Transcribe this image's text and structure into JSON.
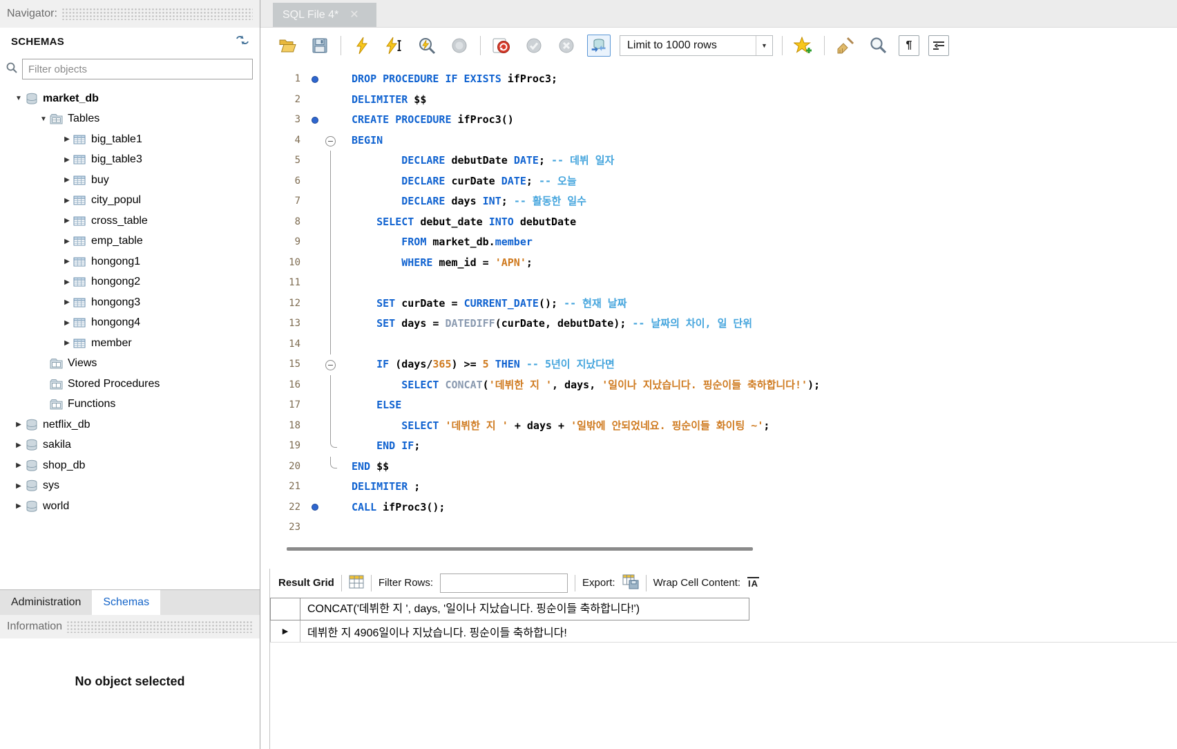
{
  "colors": {
    "keyword": "#0f62d0",
    "string": "#cf7a1f",
    "comment": "#45a5dd",
    "function": "#8a9ab0",
    "accent_blue": "#1464c8"
  },
  "navigator": {
    "title": "Navigator",
    "schemas_header": "SCHEMAS",
    "filter_placeholder": "Filter objects",
    "tree": [
      {
        "label": "market_db",
        "level": 0,
        "arrow": "down",
        "icon": "schema",
        "bold": true
      },
      {
        "label": "Tables",
        "level": 1,
        "arrow": "down",
        "icon": "tables"
      },
      {
        "label": "big_table1",
        "level": 2,
        "arrow": "right",
        "icon": "table"
      },
      {
        "label": "big_table3",
        "level": 2,
        "arrow": "right",
        "icon": "table"
      },
      {
        "label": "buy",
        "level": 2,
        "arrow": "right",
        "icon": "table"
      },
      {
        "label": "city_popul",
        "level": 2,
        "arrow": "right",
        "icon": "table"
      },
      {
        "label": "cross_table",
        "level": 2,
        "arrow": "right",
        "icon": "table"
      },
      {
        "label": "emp_table",
        "level": 2,
        "arrow": "right",
        "icon": "table"
      },
      {
        "label": "hongong1",
        "level": 2,
        "arrow": "right",
        "icon": "table"
      },
      {
        "label": "hongong2",
        "level": 2,
        "arrow": "right",
        "icon": "table"
      },
      {
        "label": "hongong3",
        "level": 2,
        "arrow": "right",
        "icon": "table"
      },
      {
        "label": "hongong4",
        "level": 2,
        "arrow": "right",
        "icon": "table"
      },
      {
        "label": "member",
        "level": 2,
        "arrow": "right",
        "icon": "table"
      },
      {
        "label": "Views",
        "level": 1,
        "arrow": null,
        "icon": "group"
      },
      {
        "label": "Stored Procedures",
        "level": 1,
        "arrow": null,
        "icon": "group"
      },
      {
        "label": "Functions",
        "level": 1,
        "arrow": null,
        "icon": "group"
      },
      {
        "label": "netflix_db",
        "level": 0,
        "arrow": "right",
        "icon": "schema"
      },
      {
        "label": "sakila",
        "level": 0,
        "arrow": "right",
        "icon": "schema"
      },
      {
        "label": "shop_db",
        "level": 0,
        "arrow": "right",
        "icon": "schema"
      },
      {
        "label": "sys",
        "level": 0,
        "arrow": "right",
        "icon": "schema"
      },
      {
        "label": "world",
        "level": 0,
        "arrow": "right",
        "icon": "schema"
      }
    ],
    "bottom_tabs": [
      {
        "label": "Administration",
        "active": false
      },
      {
        "label": "Schemas",
        "active": true
      }
    ],
    "information_header": "Information",
    "no_object": "No object selected"
  },
  "editor": {
    "tab_title": "SQL File 4*",
    "limit_dropdown": "Limit to 1000 rows",
    "toolbar_icons": [
      "open-file",
      "save",
      "execute",
      "execute-current-statement",
      "explain",
      "stop",
      "toggle-stop-on-error",
      "commit",
      "rollback",
      "toggle-autocommit",
      "limit-rows-dropdown",
      "save-snippet",
      "beautify",
      "find",
      "toggle-invisible-characters",
      "toggle-word-wrap"
    ],
    "lines": [
      {
        "n": 1,
        "m": "dot",
        "f": "",
        "s": [
          {
            "t": "kw",
            "v": "DROP PROCEDURE IF EXISTS"
          },
          {
            "t": "id",
            "v": " ifProc3;"
          }
        ]
      },
      {
        "n": 2,
        "m": "",
        "f": "",
        "s": [
          {
            "t": "kw",
            "v": "DELIMITER"
          },
          {
            "t": "id",
            "v": " $$"
          }
        ]
      },
      {
        "n": 3,
        "m": "dot",
        "f": "",
        "s": [
          {
            "t": "kw",
            "v": "CREATE PROCEDURE"
          },
          {
            "t": "id",
            "v": " ifProc3()"
          }
        ]
      },
      {
        "n": 4,
        "m": "",
        "f": "open",
        "s": [
          {
            "t": "kw",
            "v": "BEGIN"
          }
        ]
      },
      {
        "n": 5,
        "m": "",
        "f": "line",
        "s": [
          {
            "t": "id",
            "v": "        "
          },
          {
            "t": "kw",
            "v": "DECLARE"
          },
          {
            "t": "id",
            "v": " debutDate "
          },
          {
            "t": "kw",
            "v": "DATE"
          },
          {
            "t": "id",
            "v": "; "
          },
          {
            "t": "cm",
            "v": "-- 데뷔 일자"
          }
        ]
      },
      {
        "n": 6,
        "m": "",
        "f": "line",
        "s": [
          {
            "t": "id",
            "v": "        "
          },
          {
            "t": "kw",
            "v": "DECLARE"
          },
          {
            "t": "id",
            "v": " curDate "
          },
          {
            "t": "kw",
            "v": "DATE"
          },
          {
            "t": "id",
            "v": "; "
          },
          {
            "t": "cm",
            "v": "-- 오늘"
          }
        ]
      },
      {
        "n": 7,
        "m": "",
        "f": "line",
        "s": [
          {
            "t": "id",
            "v": "        "
          },
          {
            "t": "kw",
            "v": "DECLARE"
          },
          {
            "t": "id",
            "v": " days "
          },
          {
            "t": "kw",
            "v": "INT"
          },
          {
            "t": "id",
            "v": "; "
          },
          {
            "t": "cm",
            "v": "-- 활동한 일수"
          }
        ]
      },
      {
        "n": 8,
        "m": "",
        "f": "line",
        "s": [
          {
            "t": "id",
            "v": "    "
          },
          {
            "t": "kw",
            "v": "SELECT"
          },
          {
            "t": "id",
            "v": " debut_date "
          },
          {
            "t": "kw",
            "v": "INTO"
          },
          {
            "t": "id",
            "v": " debutDate"
          }
        ]
      },
      {
        "n": 9,
        "m": "",
        "f": "line",
        "s": [
          {
            "t": "id",
            "v": "        "
          },
          {
            "t": "kw",
            "v": "FROM"
          },
          {
            "t": "id",
            "v": " market_db."
          },
          {
            "t": "kw",
            "v": "member"
          }
        ]
      },
      {
        "n": 10,
        "m": "",
        "f": "line",
        "s": [
          {
            "t": "id",
            "v": "        "
          },
          {
            "t": "kw",
            "v": "WHERE"
          },
          {
            "t": "id",
            "v": " mem_id = "
          },
          {
            "t": "str",
            "v": "'APN'"
          },
          {
            "t": "id",
            "v": ";"
          }
        ]
      },
      {
        "n": 11,
        "m": "",
        "f": "line",
        "s": []
      },
      {
        "n": 12,
        "m": "",
        "f": "line",
        "s": [
          {
            "t": "id",
            "v": "    "
          },
          {
            "t": "kw",
            "v": "SET"
          },
          {
            "t": "id",
            "v": " curDate = "
          },
          {
            "t": "kw",
            "v": "CURRENT_DATE"
          },
          {
            "t": "id",
            "v": "(); "
          },
          {
            "t": "cm",
            "v": "-- 현재 날짜"
          }
        ]
      },
      {
        "n": 13,
        "m": "",
        "f": "line",
        "s": [
          {
            "t": "id",
            "v": "    "
          },
          {
            "t": "kw",
            "v": "SET"
          },
          {
            "t": "id",
            "v": " days = "
          },
          {
            "t": "fn",
            "v": "DATEDIFF"
          },
          {
            "t": "id",
            "v": "(curDate, debutDate); "
          },
          {
            "t": "cm",
            "v": "-- 날짜의 차이, 일 단위"
          }
        ]
      },
      {
        "n": 14,
        "m": "",
        "f": "line",
        "s": []
      },
      {
        "n": 15,
        "m": "",
        "f": "open",
        "s": [
          {
            "t": "id",
            "v": "    "
          },
          {
            "t": "kw",
            "v": "IF"
          },
          {
            "t": "id",
            "v": " (days/"
          },
          {
            "t": "num",
            "v": "365"
          },
          {
            "t": "id",
            "v": ") >= "
          },
          {
            "t": "num",
            "v": "5"
          },
          {
            "t": "id",
            "v": " "
          },
          {
            "t": "kw",
            "v": "THEN"
          },
          {
            "t": "id",
            "v": " "
          },
          {
            "t": "cm",
            "v": "-- 5년이 지났다면"
          }
        ]
      },
      {
        "n": 16,
        "m": "",
        "f": "line",
        "s": [
          {
            "t": "id",
            "v": "        "
          },
          {
            "t": "kw",
            "v": "SELECT"
          },
          {
            "t": "id",
            "v": " "
          },
          {
            "t": "fn",
            "v": "CONCAT"
          },
          {
            "t": "id",
            "v": "("
          },
          {
            "t": "str",
            "v": "'데뷔한 지 '"
          },
          {
            "t": "id",
            "v": ", days, "
          },
          {
            "t": "str",
            "v": "'일이나 지났습니다. 핑순이들 축하합니다!'"
          },
          {
            "t": "id",
            "v": ");"
          }
        ]
      },
      {
        "n": 17,
        "m": "",
        "f": "line",
        "s": [
          {
            "t": "id",
            "v": "    "
          },
          {
            "t": "kw",
            "v": "ELSE"
          }
        ]
      },
      {
        "n": 18,
        "m": "",
        "f": "line",
        "s": [
          {
            "t": "id",
            "v": "        "
          },
          {
            "t": "kw",
            "v": "SELECT"
          },
          {
            "t": "id",
            "v": " "
          },
          {
            "t": "str",
            "v": "'데뷔한 지 '"
          },
          {
            "t": "id",
            "v": " + days + "
          },
          {
            "t": "str",
            "v": "'일밖에 안되었네요. 핑순이들 화이팅 ~'"
          },
          {
            "t": "id",
            "v": ";"
          }
        ]
      },
      {
        "n": 19,
        "m": "",
        "f": "elbow",
        "s": [
          {
            "t": "id",
            "v": "    "
          },
          {
            "t": "kw",
            "v": "END IF"
          },
          {
            "t": "id",
            "v": ";"
          }
        ]
      },
      {
        "n": 20,
        "m": "",
        "f": "elbow",
        "s": [
          {
            "t": "kw",
            "v": "END"
          },
          {
            "t": "id",
            "v": " $$"
          }
        ]
      },
      {
        "n": 21,
        "m": "",
        "f": "",
        "s": [
          {
            "t": "kw",
            "v": "DELIMITER"
          },
          {
            "t": "id",
            "v": " ;"
          }
        ]
      },
      {
        "n": 22,
        "m": "dot",
        "f": "",
        "s": [
          {
            "t": "kw",
            "v": "CALL"
          },
          {
            "t": "id",
            "v": " ifProc3();"
          }
        ]
      },
      {
        "n": 23,
        "m": "",
        "f": "",
        "s": []
      }
    ]
  },
  "result": {
    "toolbar": {
      "result_grid": "Result Grid",
      "filter_rows": "Filter Rows:",
      "filter_value": "",
      "export": "Export:",
      "wrap": "Wrap Cell Content:",
      "wrap_glyph": "IA"
    },
    "header": "CONCAT('데뷔한 지 ', days, '일이나 지났습니다. 핑순이들 축하합니다!')",
    "row": "데뷔한 지 4906일이나 지났습니다. 핑순이들 축하합니다!"
  }
}
